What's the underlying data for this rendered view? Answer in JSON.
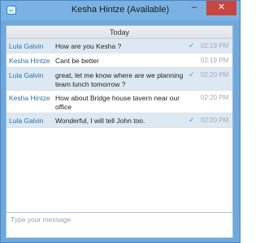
{
  "window": {
    "title": "Kesha Hintze (Available)",
    "minimize_glyph": "–",
    "close_glyph": "✕"
  },
  "chat": {
    "day_header": "Today",
    "messages": [
      {
        "sender": "Lula Galvin",
        "text": "How are you Kesha ?",
        "time": "02:19 PM",
        "delivered": true
      },
      {
        "sender": "Kesha Hintze",
        "text": "Cant be better",
        "time": "02:19 PM",
        "delivered": false
      },
      {
        "sender": "Lula Galvin",
        "text": "great, let me know where are we planning  team lunch tomorrow ?",
        "time": "02:20 PM",
        "delivered": true
      },
      {
        "sender": "Kesha Hintze",
        "text": "How about Bridge house tavern near our office",
        "time": "02:20 PM",
        "delivered": false
      },
      {
        "sender": "Lula Galvin",
        "text": "Wonderful, I will tell John too.",
        "time": "02:20 PM",
        "delivered": true
      }
    ]
  },
  "toolbar": {
    "icons": [
      "lightning-icon",
      "screen-share-icon",
      "settings-icon",
      "emoji-icon",
      "attachment-icon"
    ]
  },
  "composer": {
    "placeholder": "Type your message",
    "value": ""
  },
  "colors": {
    "title_bar": "#7ab3e3",
    "close_button": "#c7463f",
    "sender_name": "#2a6fa8",
    "alt_row": "#dde9f2",
    "check_mark": "#2ea3e0"
  }
}
